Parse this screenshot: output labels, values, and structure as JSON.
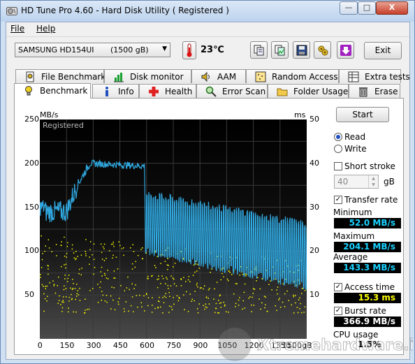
{
  "window": {
    "title": "HD Tune Pro 4.60 - Hard Disk Utility (  Registered )",
    "buttons": {
      "minimize": "—",
      "maximize": "□",
      "close": "X"
    }
  },
  "menu": {
    "file": "File",
    "help": "Help"
  },
  "toolbar": {
    "drive_name": "SAMSUNG HD154UI",
    "drive_size": "(1500 gB)",
    "temperature": "23℃",
    "exit_label": "Exit",
    "icons": [
      "copy-info-icon",
      "copy-screenshot-icon",
      "save-icon",
      "options-icon",
      "download-icon"
    ]
  },
  "tabs": {
    "row1": [
      "File Benchmark",
      "Disk monitor",
      "AAM",
      "Random Access",
      "Extra tests"
    ],
    "row2": [
      "Benchmark",
      "Info",
      "Health",
      "Error Scan",
      "Folder Usage",
      "Erase"
    ],
    "active": "Benchmark"
  },
  "graph": {
    "left_unit": "MB/s",
    "right_unit": "ms",
    "left_ticks": [
      "250",
      "200",
      "150",
      "100",
      "50"
    ],
    "right_ticks": [
      "50",
      "40",
      "30",
      "20",
      "10"
    ],
    "x_ticks": [
      "0",
      "150",
      "300",
      "450",
      "600",
      "750",
      "900",
      "1050",
      "1200",
      "1350",
      "1500gB"
    ],
    "overlay_text": "Registered",
    "transfer_color": "#30a8e0",
    "access_color": "#ffff00"
  },
  "controls": {
    "start_label": "Start",
    "read_label": "Read",
    "write_label": "Write",
    "short_stroke_label": "Short stroke",
    "short_stroke_value": "40",
    "short_stroke_unit": "gB",
    "transfer_rate_label": "Transfer rate",
    "minimum_label": "Minimum",
    "minimum_value": "52.0 MB/s",
    "maximum_label": "Maximum",
    "maximum_value": "204.1 MB/s",
    "average_label": "Average",
    "average_value": "143.3 MB/s",
    "access_time_label": "Access time",
    "access_time_value": "15.3 ms",
    "burst_rate_label": "Burst rate",
    "burst_rate_value": "366.9 MB/s",
    "cpu_usage_label": "CPU usage",
    "cpu_usage_value": "1.5%"
  },
  "watermark": {
    "text": "Xtremehardware.it"
  }
}
